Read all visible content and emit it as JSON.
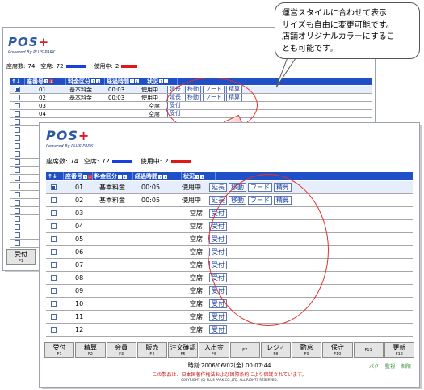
{
  "back_window": {
    "logo_main": "POS",
    "logo_plus": "+",
    "powered_by": "Powered By PLUS PARK",
    "stats": {
      "seats_label": "座席数:",
      "seats_value": "74",
      "vacant_label": "空席:",
      "vacant_value": "72",
      "inuse_label": "使用中:",
      "inuse_value": "2"
    },
    "headers": [
      "座番号",
      "料金区分",
      "経過時間",
      "状況"
    ],
    "rows": [
      {
        "no": "01",
        "fee": "基本料金",
        "time": "00:03",
        "status": "使用中",
        "actions": [
          "延長",
          "移動",
          "フード",
          "精算"
        ],
        "selected": true
      },
      {
        "no": "02",
        "fee": "基本料金",
        "time": "00:03",
        "status": "使用中",
        "actions": [
          "延長",
          "移動",
          "フード",
          "精算"
        ],
        "selected": false
      },
      {
        "no": "03",
        "fee": "",
        "time": "",
        "status": "空席",
        "actions": [
          "受付"
        ],
        "selected": false
      },
      {
        "no": "04",
        "fee": "",
        "time": "",
        "status": "空席",
        "actions": [
          "受付"
        ],
        "selected": false
      }
    ],
    "fkey_label": "受付",
    "fkey_num": "F1"
  },
  "front_window": {
    "logo_main": "POS",
    "logo_plus": "+",
    "powered_by": "Powered By PLUS PARK",
    "stats": {
      "seats_label": "座席数:",
      "seats_value": "74",
      "vacant_label": "空席:",
      "vacant_value": "72",
      "inuse_label": "使用中:",
      "inuse_value": "2"
    },
    "headers": [
      "座番号",
      "料金区分",
      "経過時間",
      "状況"
    ],
    "rows": [
      {
        "no": "01",
        "fee": "基本料金",
        "time": "00:05",
        "status": "使用中",
        "actions": [
          "延長",
          "移動",
          "フード",
          "精算"
        ],
        "selected": true
      },
      {
        "no": "02",
        "fee": "基本料金",
        "time": "00:05",
        "status": "使用中",
        "actions": [
          "延長",
          "移動",
          "フード",
          "精算"
        ],
        "selected": false
      },
      {
        "no": "03",
        "fee": "",
        "time": "",
        "status": "空席",
        "actions": [
          "受付"
        ],
        "selected": false
      },
      {
        "no": "04",
        "fee": "",
        "time": "",
        "status": "空席",
        "actions": [
          "受付"
        ],
        "selected": false
      },
      {
        "no": "05",
        "fee": "",
        "time": "",
        "status": "空席",
        "actions": [
          "受付"
        ],
        "selected": false
      },
      {
        "no": "06",
        "fee": "",
        "time": "",
        "status": "空席",
        "actions": [
          "受付"
        ],
        "selected": false
      },
      {
        "no": "07",
        "fee": "",
        "time": "",
        "status": "空席",
        "actions": [
          "受付"
        ],
        "selected": false
      },
      {
        "no": "08",
        "fee": "",
        "time": "",
        "status": "空席",
        "actions": [
          "受付"
        ],
        "selected": false
      },
      {
        "no": "09",
        "fee": "",
        "time": "",
        "status": "空席",
        "actions": [
          "受付"
        ],
        "selected": false
      },
      {
        "no": "10",
        "fee": "",
        "time": "",
        "status": "空席",
        "actions": [
          "受付"
        ],
        "selected": false
      },
      {
        "no": "11",
        "fee": "",
        "time": "",
        "status": "空席",
        "actions": [
          "受付"
        ],
        "selected": false
      },
      {
        "no": "12",
        "fee": "",
        "time": "",
        "status": "空席",
        "actions": [
          "受付"
        ],
        "selected": false
      }
    ],
    "fkeys": [
      {
        "label": "受付",
        "num": "F1"
      },
      {
        "label": "精算",
        "num": "F2"
      },
      {
        "label": "会員",
        "num": "F3"
      },
      {
        "label": "販売",
        "num": "F4"
      },
      {
        "label": "注文確認",
        "num": "F5"
      },
      {
        "label": "入出金",
        "num": "F6"
      },
      {
        "label": "",
        "num": "F7"
      },
      {
        "label": "レジ",
        "num": "F8"
      },
      {
        "label": "勤怠",
        "num": "F9"
      },
      {
        "label": "保守",
        "num": "F10"
      },
      {
        "label": "",
        "num": "F11"
      },
      {
        "label": "更新",
        "num": "F12"
      }
    ],
    "clock": "時刻:2006/06/02(金) 00:07:44",
    "links": [
      "パク",
      "監視",
      "制限"
    ],
    "notice": "この製品は、日本国著作権法および国際条約により保護されています。",
    "copyright": "COPYRIGHT (C) PLUS PARK CO.,LTD. ALL RIGHTS RESERVED."
  },
  "callout": {
    "line1": "運営スタイルに合わせて表示",
    "line2": "サイズも自由に変更可能です。",
    "line3": "店舗オリジナルカラーにするこ",
    "line4": "とも可能です。"
  },
  "colors": {
    "header_blue": "#2050c8",
    "vacant_bar": "#1a3fe0",
    "inuse_bar": "#e01818",
    "annotation_red": "#e23030"
  }
}
